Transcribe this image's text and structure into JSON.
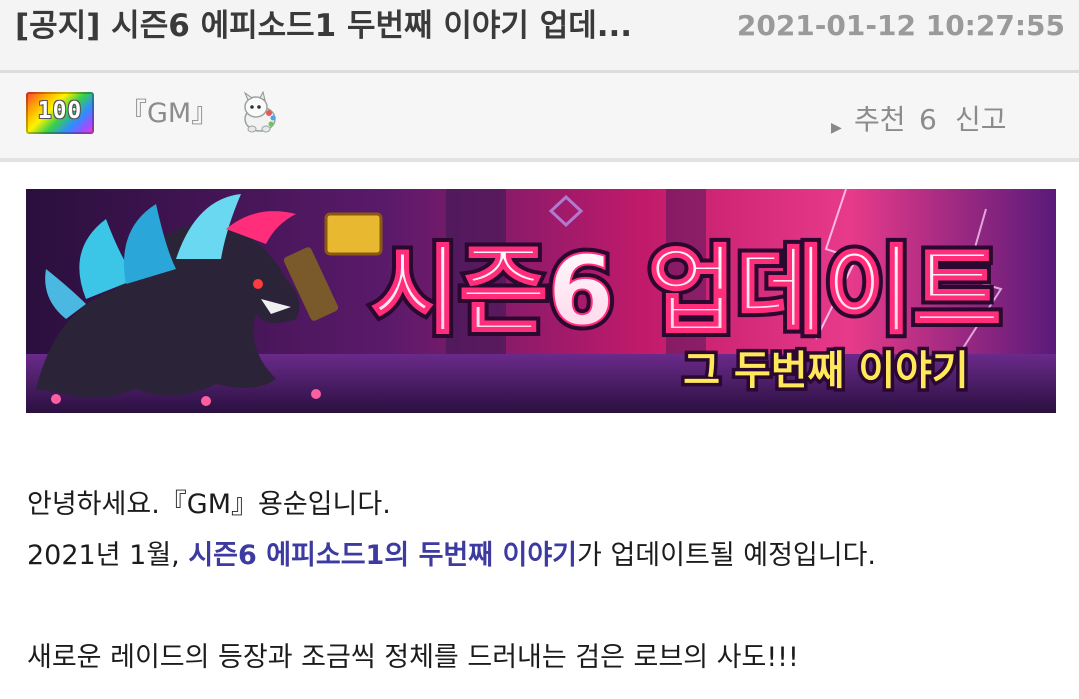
{
  "header": {
    "title": "[공지] 시즌6 에피소드1 두번째 이야기 업데...",
    "timestamp": "2021-01-12 10:27:55"
  },
  "author_bar": {
    "level": "100",
    "nickname": "『GM』",
    "pet_icon": "white-creature-icon",
    "recommend_label": "추천",
    "recommend_count": "6",
    "report_label": "신고"
  },
  "banner": {
    "main_text": "시즌6 업데이트",
    "sub_text": "그 두번째 이야기"
  },
  "content": {
    "line1": "안녕하세요.『GM』용순입니다.",
    "line2_prefix": "2021년 1월, ",
    "line2_highlight": "시즌6 에피소드1의 두번째 이야기",
    "line2_suffix": "가 업데이트될 예정입니다.",
    "line4": "새로운 레이드의 등장과 조금씩 정체를 드러내는 검은 로브의 사도!!!"
  },
  "colors": {
    "highlight": "#3d3aa0",
    "header_bg": "#f4f4f4",
    "banner_pink": "#ff2d7a"
  }
}
